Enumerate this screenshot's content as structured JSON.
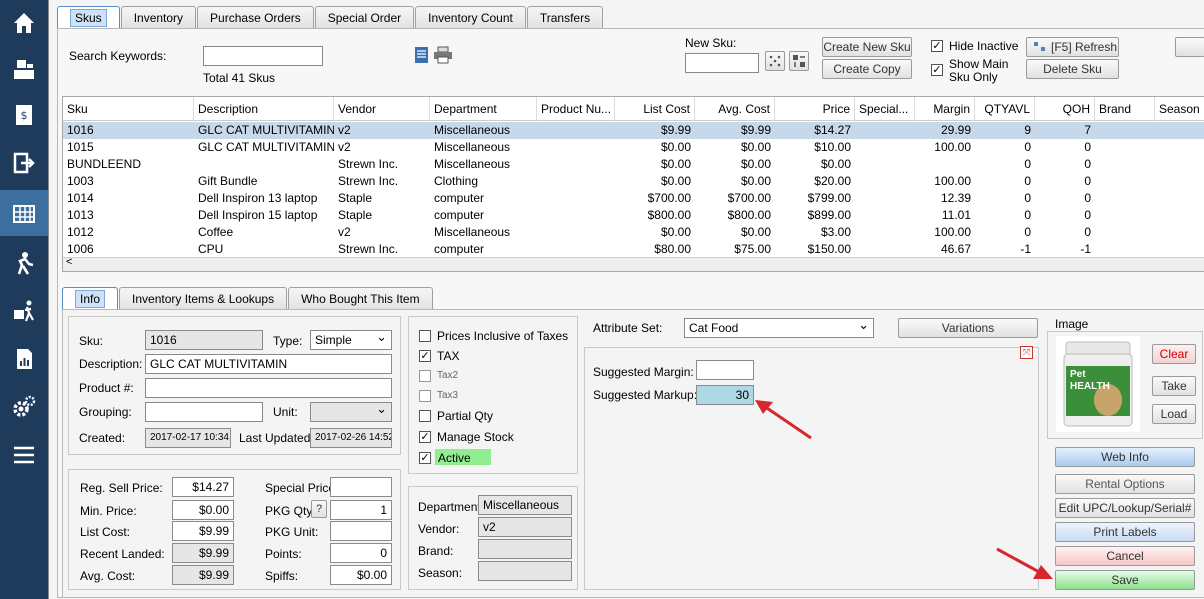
{
  "sidebar": {
    "items": [
      "home-icon",
      "register-icon",
      "invoice-icon",
      "logout-icon",
      "inventory-icon",
      "customer-icon",
      "shipping-icon",
      "reports-icon",
      "settings-icon",
      "menu-icon"
    ],
    "active_index": 4
  },
  "top_tabs": [
    "Skus",
    "Inventory",
    "Purchase Orders",
    "Special Order",
    "Inventory Count",
    "Transfers"
  ],
  "search": {
    "label": "Search Keywords:",
    "value": "",
    "total": "Total 41 Skus"
  },
  "new_sku": {
    "label": "New Sku:",
    "value": ""
  },
  "toolbar": {
    "create_new": "Create New Sku",
    "create_copy": "Create Copy",
    "hide_inactive": "Hide Inactive",
    "show_main_line1": "Show Main",
    "show_main_line2": "Sku Only",
    "refresh": "[F5] Refresh",
    "delete": "Delete Sku"
  },
  "grid": {
    "columns": [
      "Sku",
      "Description",
      "Vendor",
      "Department",
      "Product Nu...",
      "List Cost",
      "Avg. Cost",
      "Price",
      "Special...",
      "Margin",
      "QTYAVL",
      "QOH",
      "Brand",
      "Season"
    ],
    "rows": [
      [
        "1016",
        "GLC CAT MULTIVITAMIN",
        "v2",
        "Miscellaneous",
        "",
        "$9.99",
        "$9.99",
        "$14.27",
        "",
        "29.99",
        "9",
        "7",
        "",
        ""
      ],
      [
        "1015",
        "GLC CAT MULTIVITAMIN",
        "v2",
        "Miscellaneous",
        "",
        "$0.00",
        "$0.00",
        "$10.00",
        "",
        "100.00",
        "0",
        "0",
        "",
        ""
      ],
      [
        "BUNDLEEND",
        "",
        "Strewn Inc.",
        "Miscellaneous",
        "",
        "$0.00",
        "$0.00",
        "$0.00",
        "",
        "",
        "0",
        "0",
        "",
        ""
      ],
      [
        "1003",
        "Gift Bundle",
        "Strewn Inc.",
        "Clothing",
        "",
        "$0.00",
        "$0.00",
        "$20.00",
        "",
        "100.00",
        "0",
        "0",
        "",
        ""
      ],
      [
        "1014",
        "Dell Inspiron 13 laptop",
        "Staple",
        "computer",
        "",
        "$700.00",
        "$700.00",
        "$799.00",
        "",
        "12.39",
        "0",
        "0",
        "",
        ""
      ],
      [
        "1013",
        "Dell Inspiron 15 laptop",
        "Staple",
        "computer",
        "",
        "$800.00",
        "$800.00",
        "$899.00",
        "",
        "11.01",
        "0",
        "0",
        "",
        ""
      ],
      [
        "1012",
        "Coffee",
        "v2",
        "Miscellaneous",
        "",
        "$0.00",
        "$0.00",
        "$3.00",
        "",
        "100.00",
        "0",
        "0",
        "",
        ""
      ],
      [
        "1006",
        "CPU",
        "Strewn Inc.",
        "computer",
        "",
        "$80.00",
        "$75.00",
        "$150.00",
        "",
        "46.67",
        "-1",
        "-1",
        "",
        ""
      ]
    ]
  },
  "detail_tabs": [
    "Info",
    "Inventory Items & Lookups",
    "Who Bought This Item"
  ],
  "info": {
    "sku_label": "Sku:",
    "sku": "1016",
    "type_label": "Type:",
    "type": "Simple",
    "desc_label": "Description:",
    "desc": "GLC CAT MULTIVITAMIN",
    "product_label": "Product #:",
    "product": "",
    "grouping_label": "Grouping:",
    "grouping": "",
    "unit_label": "Unit:",
    "unit": "",
    "created_label": "Created:",
    "created": "2017-02-17 10:34",
    "updated_label": "Last Updated:",
    "updated": "2017-02-26 14:52"
  },
  "prices": {
    "reg_label": "Reg. Sell Price:",
    "reg": "$14.27",
    "min_label": "Min. Price:",
    "min": "$0.00",
    "list_label": "List Cost:",
    "list": "$9.99",
    "landed_label": "Recent Landed:",
    "landed": "$9.99",
    "avg_label": "Avg. Cost:",
    "avg": "$9.99",
    "special_label": "Special Price:",
    "special": "",
    "pkg_qty_label": "PKG Qty:",
    "pkg_help": "?",
    "pkg_qty": "1",
    "pkg_unit_label": "PKG Unit:",
    "pkg_unit": "",
    "points_label": "Points:",
    "points": "0",
    "spiffs_label": "Spiffs:",
    "spiffs": "$0.00"
  },
  "options": {
    "prices_inclusive": "Prices Inclusive of Taxes",
    "tax": "TAX",
    "tax2": "Tax2",
    "tax3": "Tax3",
    "partial": "Partial Qty",
    "manage": "Manage Stock",
    "active": "Active"
  },
  "dept": {
    "dept_label": "Department:",
    "dept": "Miscellaneous",
    "vendor_label": "Vendor:",
    "vendor": "v2",
    "brand_label": "Brand:",
    "brand": "",
    "season_label": "Season:",
    "season": ""
  },
  "attributes": {
    "set_label": "Attribute Set:",
    "set": "Cat Food",
    "variations": "Variations",
    "margin_label": "Suggested Margin:",
    "margin": "",
    "markup_label": "Suggested Markup:",
    "markup": "30"
  },
  "image": {
    "label": "Image",
    "product_text": "Pet HEALTH",
    "clear": "Clear",
    "take": "Take",
    "load": "Load"
  },
  "actions": {
    "web_info": "Web Info",
    "rental": "Rental Options",
    "edit_upc": "Edit UPC/Lookup/Serial#",
    "print_labels": "Print Labels",
    "cancel": "Cancel",
    "save": "Save"
  },
  "colors": {
    "sidebar": "#1f3b5c",
    "sidebar_active": "#3c6f9f",
    "selected_row": "#c7d8ea",
    "active_green": "#90ee90",
    "markup_blue": "#add8e6",
    "arrow_red": "#d9262c"
  }
}
